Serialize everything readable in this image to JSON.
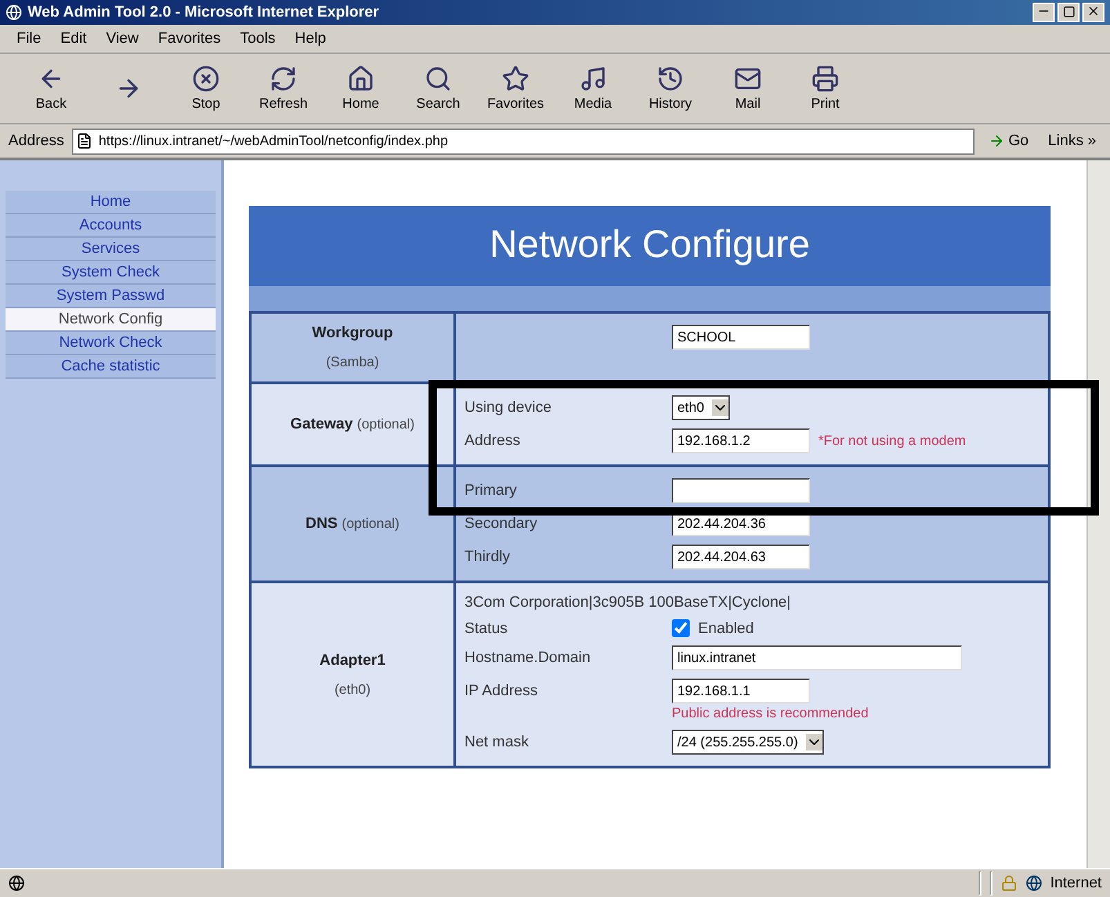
{
  "window": {
    "title": "Web Admin Tool 2.0 - Microsoft Internet Explorer"
  },
  "menu": [
    "File",
    "Edit",
    "View",
    "Favorites",
    "Tools",
    "Help"
  ],
  "toolbar": [
    {
      "kind": "back",
      "label": "Back"
    },
    {
      "kind": "forward"
    },
    {
      "kind": "stop",
      "label": "Stop"
    },
    {
      "kind": "refresh",
      "label": "Refresh"
    },
    {
      "kind": "home",
      "label": "Home"
    },
    {
      "kind": "search",
      "label": "Search"
    },
    {
      "kind": "favorites",
      "label": "Favorites"
    },
    {
      "kind": "media",
      "label": "Media"
    },
    {
      "kind": "history",
      "label": "History"
    },
    {
      "kind": "mail",
      "label": "Mail"
    },
    {
      "kind": "print",
      "label": "Print"
    }
  ],
  "address_bar": {
    "label": "Address",
    "url": "https://linux.intranet/~/webAdminTool/netconfig/index.php",
    "go": "Go",
    "links": "Links »"
  },
  "sidebar": {
    "items": [
      {
        "label": "Home",
        "selected": false
      },
      {
        "label": "Accounts",
        "selected": false
      },
      {
        "label": "Services",
        "selected": false
      },
      {
        "label": "System Check",
        "selected": false
      },
      {
        "label": "System Passwd",
        "selected": false
      },
      {
        "label": "Network Config",
        "selected": true
      },
      {
        "label": "Network Check",
        "selected": false
      },
      {
        "label": "Cache statistic",
        "selected": false
      }
    ]
  },
  "page": {
    "title": "Network Configure",
    "sections": [
      {
        "label": "Workgroup",
        "sublabel": "(Samba)",
        "stacked": true,
        "fields": [
          {
            "kind": "input",
            "value": "SCHOOL",
            "wide": false
          }
        ]
      },
      {
        "label": "Gateway",
        "sublabel": "(optional)",
        "stacked": false,
        "fields": [
          {
            "kind": "select",
            "label": "Using device",
            "value": "eth0"
          },
          {
            "kind": "input",
            "label": "Address",
            "value": "192.168.1.2",
            "note": "*For not using a modem",
            "below": false,
            "wide": false
          }
        ]
      },
      {
        "label": "DNS",
        "sublabel": "(optional)",
        "stacked": false,
        "fields": [
          {
            "kind": "input",
            "label": "Primary",
            "wide": false
          },
          {
            "kind": "input",
            "label": "Secondary",
            "value": "202.44.204.36",
            "wide": false
          },
          {
            "kind": "input",
            "label": "Thirdly",
            "value": "202.44.204.63",
            "wide": false
          }
        ]
      },
      {
        "label": "Adapter1",
        "sublabel": "(eth0)",
        "stacked": true,
        "fields": [
          {
            "kind": "text",
            "label": "3Com Corporation|3c905B 100BaseTX|Cyclone|"
          },
          {
            "kind": "checkbox",
            "label": "Status",
            "value": "Enabled",
            "checked": true
          },
          {
            "kind": "input",
            "label": "Hostname.Domain",
            "value": "linux.intranet",
            "wide": true
          },
          {
            "kind": "input",
            "label": "IP Address",
            "value": "192.168.1.1",
            "note": "Public address is recommended",
            "below": true,
            "wide": false
          },
          {
            "kind": "select",
            "label": "Net mask",
            "value": "/24 (255.255.255.0)"
          }
        ]
      }
    ]
  },
  "status_bar": {
    "zone": "Internet"
  }
}
